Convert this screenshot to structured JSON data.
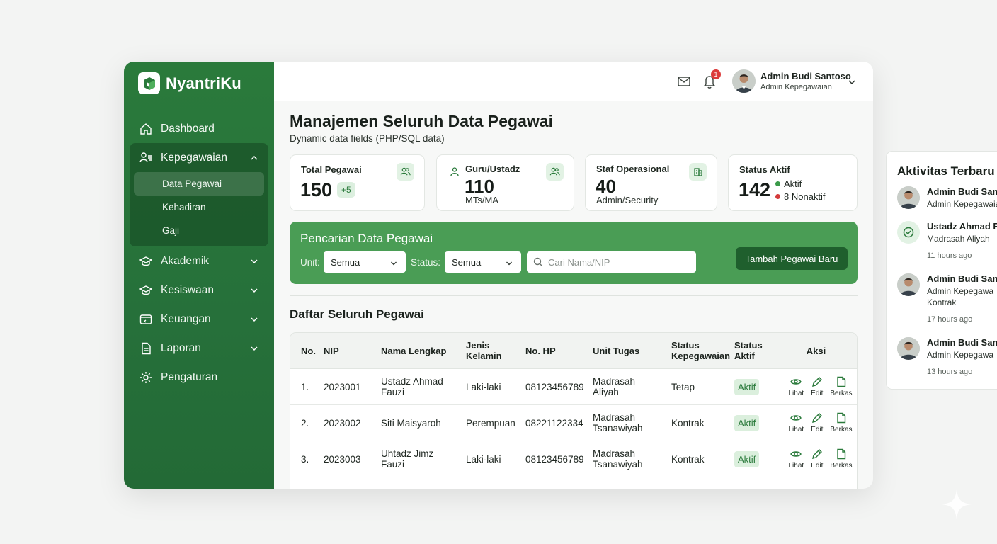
{
  "brand": {
    "name": "NyantriKu"
  },
  "sidebar": {
    "items": [
      {
        "label": "Dashboard",
        "icon": "home-icon"
      },
      {
        "label": "Kepegawaian",
        "icon": "users-list-icon",
        "expanded": true,
        "sub": [
          {
            "label": "Data Pegawai",
            "active": true
          },
          {
            "label": "Kehadiran"
          },
          {
            "label": "Gaji"
          }
        ]
      },
      {
        "label": "Akademik",
        "icon": "graduation-cap-icon"
      },
      {
        "label": "Kesiswaan",
        "icon": "graduation-cap-icon"
      },
      {
        "label": "Keuangan",
        "icon": "wallet-icon"
      },
      {
        "label": "Laporan",
        "icon": "document-icon"
      },
      {
        "label": "Pengaturan",
        "icon": "gear-icon"
      }
    ]
  },
  "topbar": {
    "notification_count": "1",
    "user_name": "Admin Budi Santoso",
    "user_role": "Admin Kepegawaian"
  },
  "page": {
    "title": "Manajemen Seluruh Data Pegawai",
    "subtitle": "Dynamic data fields (PHP/SQL data)"
  },
  "stats": {
    "total": {
      "title": "Total Pegawai",
      "value": "150",
      "delta": "+5"
    },
    "guru": {
      "title": "Guru/Ustadz",
      "value": "110",
      "note": "MTs/MA"
    },
    "staf": {
      "title": "Staf Operasional",
      "value": "40",
      "note": "Admin/Security"
    },
    "status": {
      "title": "Status Aktif",
      "value": "142",
      "aktif": "Aktif",
      "nonaktif": "8 Nonaktif"
    }
  },
  "search": {
    "title": "Pencarian Data Pegawai",
    "unit_label": "Unit:",
    "unit_value": "Semua",
    "status_label": "Status:",
    "status_value": "Semua",
    "placeholder": "Cari Nama/NIP",
    "add_button": "Tambah Pegawai Baru"
  },
  "list": {
    "title": "Daftar Seluruh Pegawai",
    "columns": {
      "no": "No.",
      "nip": "NIP",
      "nama": "Nama Lengkap",
      "jk_1": "Jenis",
      "jk_2": "Kelamin",
      "hp": "No. HP",
      "unit": "Unit Tugas",
      "kep_1": "Status",
      "kep_2": "Kepegawaian",
      "akt_1": "Status",
      "akt_2": "Aktif",
      "aksi": "Aksi"
    },
    "actions": {
      "view": "Lihat",
      "edit": "Edit",
      "files": "Berkas"
    },
    "rows": [
      {
        "no": "1.",
        "nip": "2023001",
        "nama_1": "Ustadz Ahmad",
        "nama_2": "Fauzi",
        "jk": "Laki-laki",
        "hp": "08123456789",
        "unit_1": "Madrasah Aliyah",
        "unit_2": "",
        "kep": "Tetap",
        "akt": "Aktif"
      },
      {
        "no": "2.",
        "nip": "2023002",
        "nama_1": "Siti Maisyaroh",
        "nama_2": "",
        "jk": "Perempuan",
        "hp": "08221122334",
        "unit_1": "Madrasah",
        "unit_2": "Tsanawiyah",
        "kep": "Kontrak",
        "akt": "Aktif"
      },
      {
        "no": "3.",
        "nip": "2023003",
        "nama_1": "Uhtadz Jimz Fauzi",
        "nama_2": "",
        "jk": "Laki-laki",
        "hp": "08123456789",
        "unit_1": "Madrasah",
        "unit_2": "Tsanawiyah",
        "kep": "Kontrak",
        "akt": "Aktif"
      }
    ]
  },
  "activity": {
    "title": "Aktivitas Terbaru P",
    "entries": [
      {
        "name": "Admin Budi Santo",
        "desc_1": "Admin Kepegawaia",
        "desc_2": "",
        "desc_3": "",
        "time": ""
      },
      {
        "name": "Ustadz Ahmad Fa",
        "desc_1": "Madrasah Aliyah",
        "desc_2": "",
        "desc_3": "",
        "time": "11 hours ago"
      },
      {
        "name": "Admin Budi Santo",
        "desc_1": "Admin Kepegawa",
        "desc_2": "Kontrak",
        "desc_3": "",
        "time": "17 hours ago"
      },
      {
        "name": "Admin Budi Santo",
        "desc_1": "Admin Kepegawa",
        "desc_2": "",
        "desc_3": "",
        "time": "13 hours ago"
      }
    ]
  },
  "colors": {
    "sidebar": "#26703a",
    "accent": "#4a9d55",
    "button_dark": "#1f5f2d",
    "badge": "#dc3a3a"
  }
}
